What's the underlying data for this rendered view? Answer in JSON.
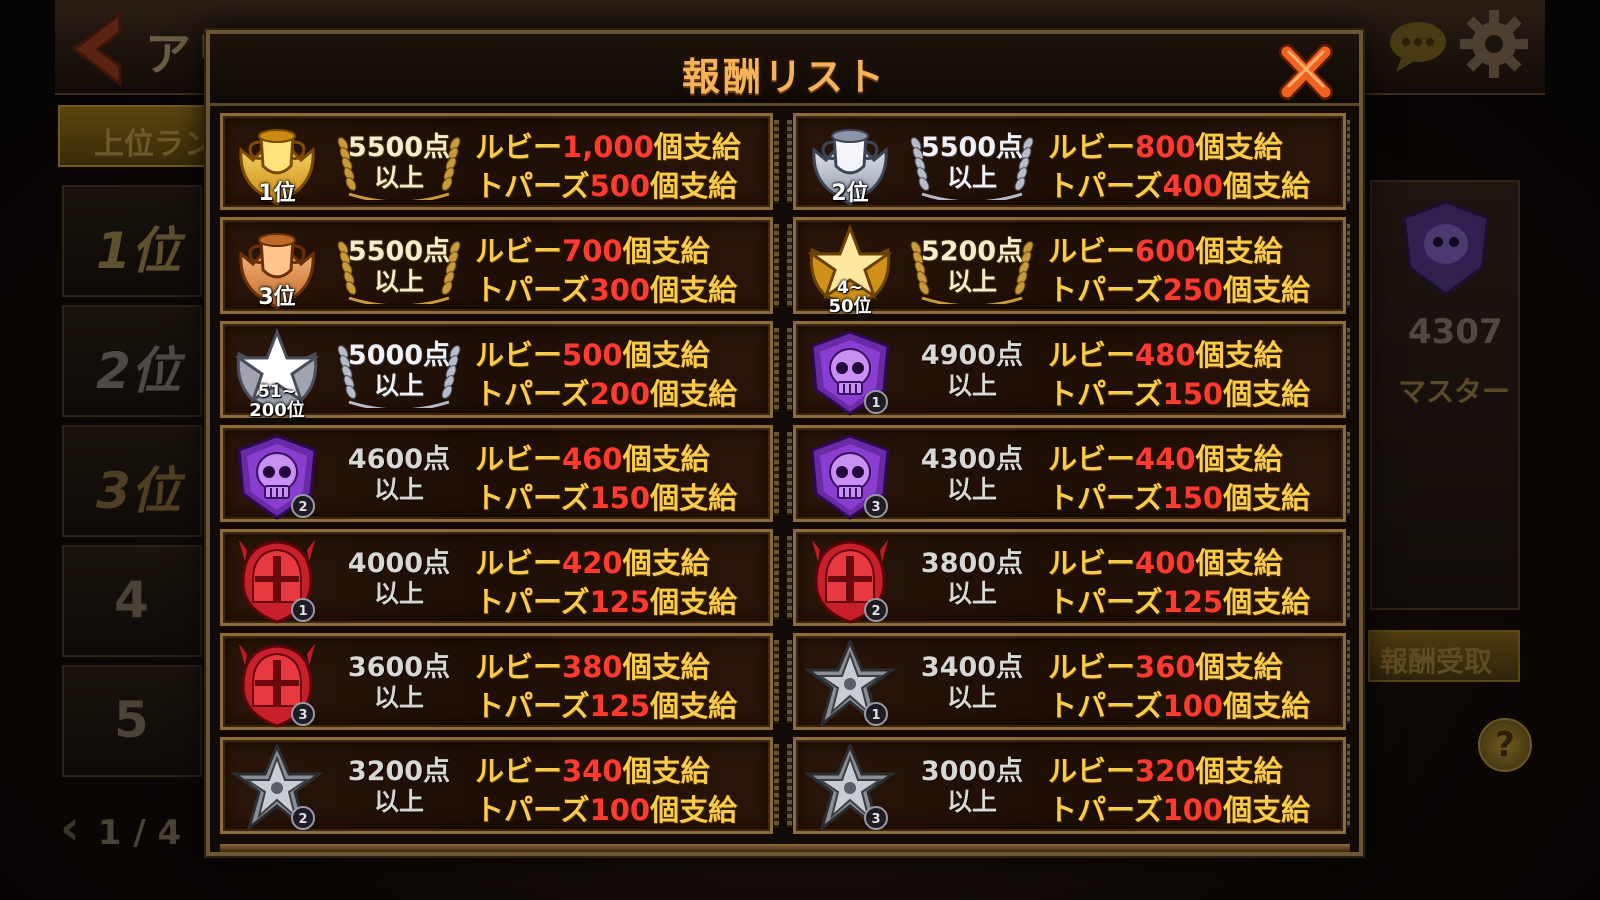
{
  "background": {
    "title": "アリーナ",
    "tab_label": "上位ラン",
    "ranks": [
      "1位",
      "2位",
      "3位",
      "4",
      "5"
    ],
    "pager": "1 / 4",
    "right_panel": {
      "points": "4307",
      "rank_name": "マスター",
      "claim_label": "報酬受取"
    },
    "help_label": "?"
  },
  "modal": {
    "title": "報酬リスト",
    "close_icon": "close-x-icon",
    "ruby_label": "ルビー",
    "topaz_label": "トパーズ",
    "unit_suffix": "個支給",
    "rows": [
      {
        "badge": "gold-trophy",
        "badge_label": "1位",
        "threshold_top": "5500点",
        "threshold_bottom": "以上",
        "style": "gold",
        "ruby": "1,000",
        "topaz": "500"
      },
      {
        "badge": "silver-trophy",
        "badge_label": "2位",
        "threshold_top": "5500点",
        "threshold_bottom": "以上",
        "style": "silver",
        "ruby": "800",
        "topaz": "400"
      },
      {
        "badge": "bronze-trophy",
        "badge_label": "3位",
        "threshold_top": "5500点",
        "threshold_bottom": "以上",
        "style": "gold",
        "ruby": "700",
        "topaz": "300"
      },
      {
        "badge": "gold-star",
        "badge_label": "4~",
        "badge_label2": "50位",
        "threshold_top": "5200点",
        "threshold_bottom": "以上",
        "style": "gold",
        "ruby": "600",
        "topaz": "250"
      },
      {
        "badge": "silver-star",
        "badge_label": "51~",
        "badge_label2": "200位",
        "threshold_top": "5000点",
        "threshold_bottom": "以上",
        "style": "silver",
        "ruby": "500",
        "topaz": "200"
      },
      {
        "badge": "purple-skull-1",
        "badge_label": "",
        "threshold_top": "4900点",
        "threshold_bottom": "以上",
        "style": "plain",
        "ruby": "480",
        "topaz": "150"
      },
      {
        "badge": "purple-skull-2",
        "badge_label": "",
        "threshold_top": "4600点",
        "threshold_bottom": "以上",
        "style": "plain",
        "ruby": "460",
        "topaz": "150"
      },
      {
        "badge": "purple-skull-3",
        "badge_label": "",
        "threshold_top": "4300点",
        "threshold_bottom": "以上",
        "style": "plain",
        "ruby": "440",
        "topaz": "150"
      },
      {
        "badge": "red-helmet-1",
        "badge_label": "",
        "threshold_top": "4000点",
        "threshold_bottom": "以上",
        "style": "plain",
        "ruby": "420",
        "topaz": "125"
      },
      {
        "badge": "red-helmet-2",
        "badge_label": "",
        "threshold_top": "3800点",
        "threshold_bottom": "以上",
        "style": "plain",
        "ruby": "400",
        "topaz": "125"
      },
      {
        "badge": "red-helmet-3",
        "badge_label": "",
        "threshold_top": "3600点",
        "threshold_bottom": "以上",
        "style": "plain",
        "ruby": "380",
        "topaz": "125"
      },
      {
        "badge": "iron-cross-1",
        "badge_label": "",
        "threshold_top": "3400点",
        "threshold_bottom": "以上",
        "style": "plain",
        "ruby": "360",
        "topaz": "100"
      },
      {
        "badge": "iron-cross-2",
        "badge_label": "",
        "threshold_top": "3200点",
        "threshold_bottom": "以上",
        "style": "plain",
        "ruby": "340",
        "topaz": "100"
      },
      {
        "badge": "iron-cross-3",
        "badge_label": "",
        "threshold_top": "3000点",
        "threshold_bottom": "以上",
        "style": "plain",
        "ruby": "320",
        "topaz": "100"
      }
    ]
  },
  "colors": {
    "title": "#f4b35a",
    "reward_label": "#f9cc4a",
    "reward_number": "#ff3b30",
    "frame": "#8b6b3a",
    "close_x": "#e8501e"
  }
}
